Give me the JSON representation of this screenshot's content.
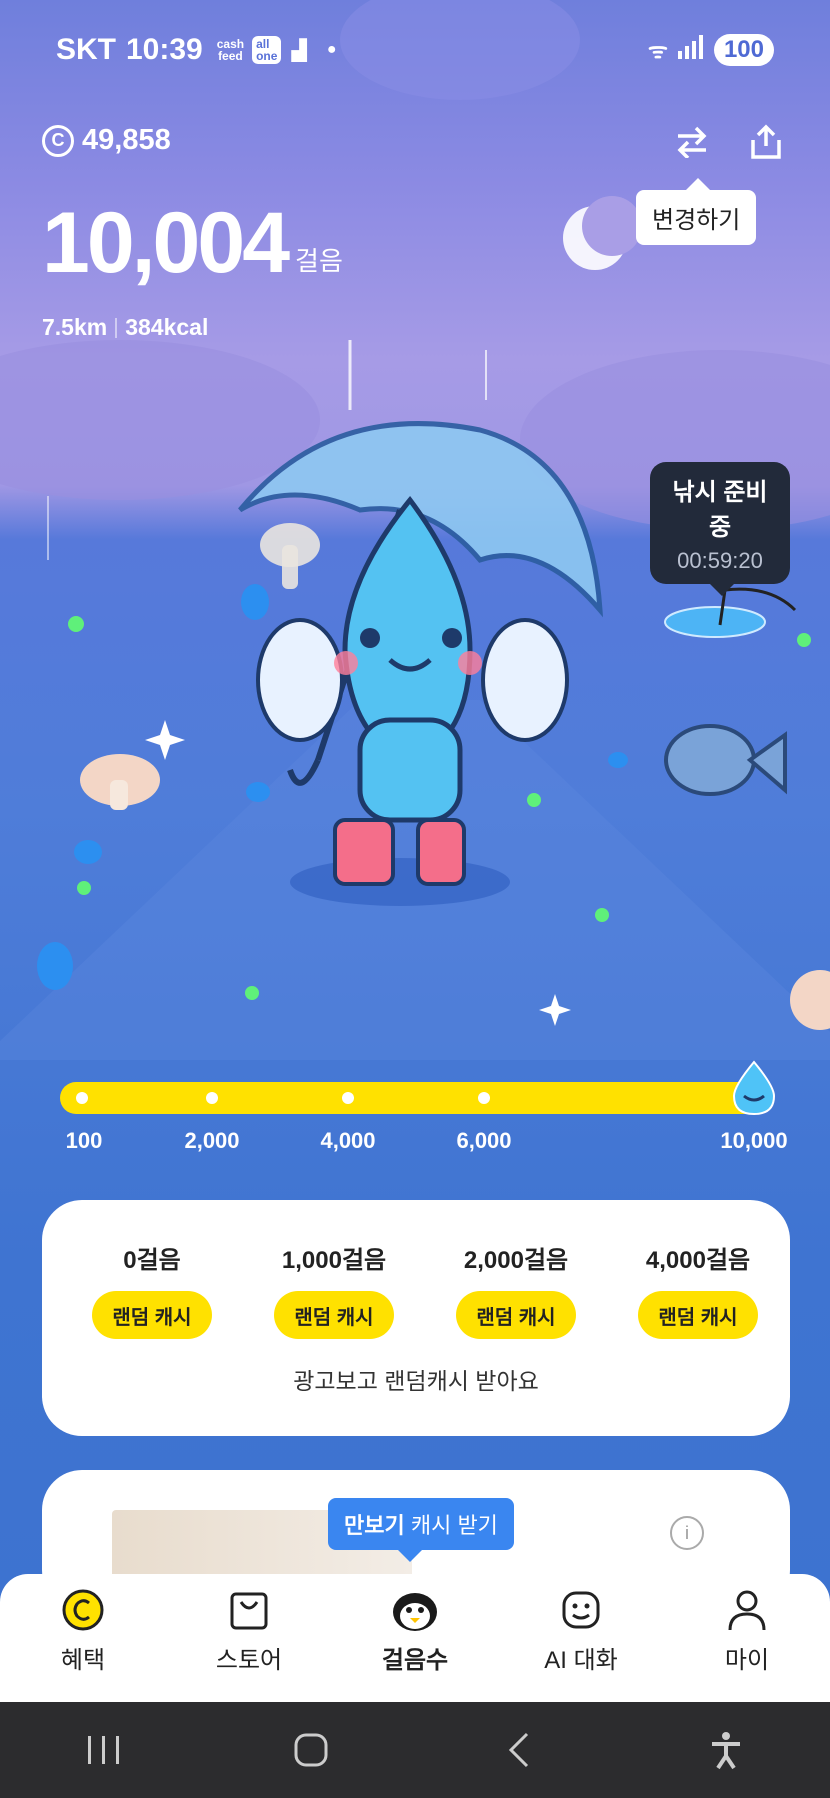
{
  "status_bar": {
    "carrier": "SKT",
    "time": "10:39",
    "cashfeed_top": "cash",
    "cashfeed_bottom": "feed",
    "allinone_top": "all",
    "allinone_bottom": "one",
    "battery": "100"
  },
  "header": {
    "coin_balance": "49,858",
    "change_tooltip": "변경하기"
  },
  "walk": {
    "steps": "10,004",
    "steps_unit": "걸음",
    "distance": "7.5km",
    "calories": "384kcal"
  },
  "fishing": {
    "title": "낚시 준비중",
    "timer": "00:59:20"
  },
  "progress": {
    "fraction": 1.0,
    "labels": [
      "100",
      "2,000",
      "4,000",
      "6,000",
      "10,000"
    ]
  },
  "rewards": {
    "items": [
      {
        "label": "0걸음",
        "button": "랜덤 캐시"
      },
      {
        "label": "1,000걸음",
        "button": "랜덤 캐시"
      },
      {
        "label": "2,000걸음",
        "button": "랜덤 캐시"
      },
      {
        "label": "4,000걸음",
        "button": "랜덤 캐시"
      }
    ],
    "footer": "광고보고 랜덤캐시 받아요"
  },
  "promo": {
    "tip_bold": "만보기",
    "tip_rest": " 캐시 받기",
    "info_icon": "i"
  },
  "tabs": [
    {
      "label": "혜택",
      "icon": "coin-icon"
    },
    {
      "label": "스토어",
      "icon": "bag-icon"
    },
    {
      "label": "걸음수",
      "icon": "penguin-icon"
    },
    {
      "label": "AI 대화",
      "icon": "smile-icon"
    },
    {
      "label": "마이",
      "icon": "person-icon"
    }
  ],
  "colors": {
    "accent_yellow": "#ffe100",
    "tip_blue": "#3a86f0"
  }
}
